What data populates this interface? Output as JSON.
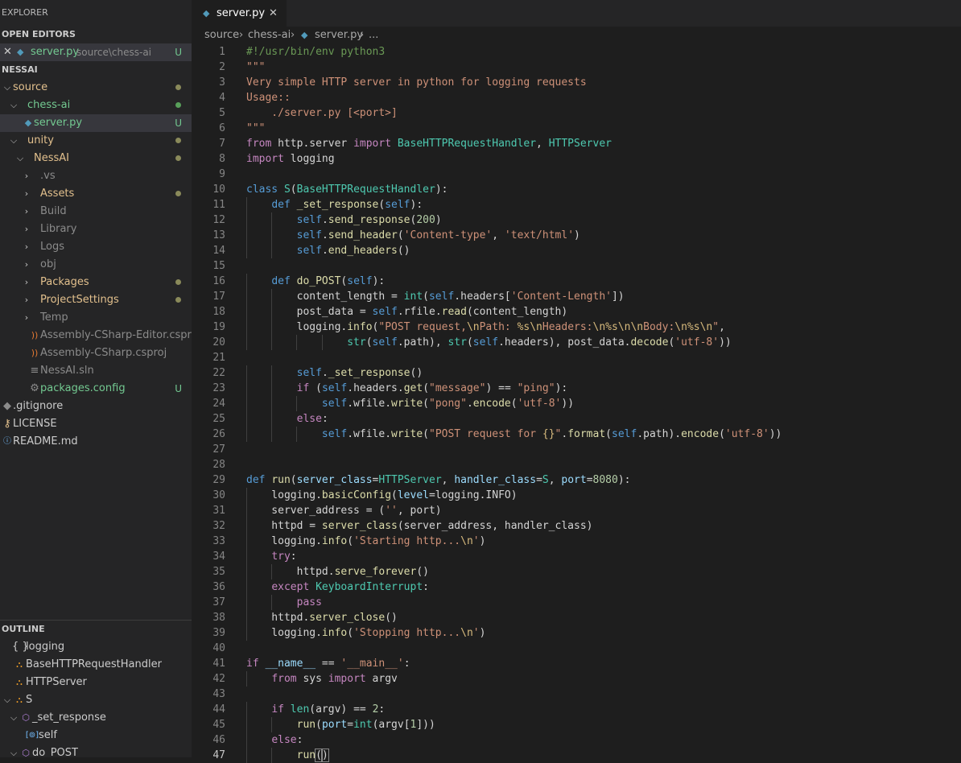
{
  "explorer": {
    "title": "EXPLORER"
  },
  "open_editors": {
    "title": "OPEN EDITORS",
    "items": [
      {
        "close": "✕",
        "name": "server.py",
        "path": "source\\chess-ai",
        "badge": "U"
      }
    ]
  },
  "workspace": {
    "title": "NESSAI",
    "tree": [
      {
        "label": "source",
        "chevron": "⌵",
        "status": "modified"
      },
      {
        "label": "chess-ai",
        "chevron": "⌵",
        "status": "untracked"
      },
      {
        "label": "server.py",
        "icon": "python-file-icon",
        "badge": "U",
        "selected": true
      },
      {
        "label": "unity",
        "chevron": "⌵",
        "status": "modified"
      },
      {
        "label": "NessAI",
        "chevron": "⌵",
        "status": "modified"
      },
      {
        "label": ".vs",
        "chevron": "›"
      },
      {
        "label": "Assets",
        "chevron": "›",
        "status": "modified"
      },
      {
        "label": "Build",
        "chevron": "›"
      },
      {
        "label": "Library",
        "chevron": "›"
      },
      {
        "label": "Logs",
        "chevron": "›"
      },
      {
        "label": "obj",
        "chevron": "›"
      },
      {
        "label": "Packages",
        "chevron": "›",
        "status": "modified"
      },
      {
        "label": "ProjectSettings",
        "chevron": "›",
        "status": "modified"
      },
      {
        "label": "Temp",
        "chevron": "›"
      },
      {
        "label": "Assembly-CSharp-Editor.csproj",
        "icon": "rss-icon"
      },
      {
        "label": "Assembly-CSharp.csproj",
        "icon": "rss-icon"
      },
      {
        "label": "NessAI.sln",
        "icon": "lines-icon"
      },
      {
        "label": "packages.config",
        "icon": "gear-icon",
        "badge": "U"
      },
      {
        "label": ".gitignore",
        "icon": "diamond-icon"
      },
      {
        "label": "LICENSE",
        "icon": "key-icon"
      },
      {
        "label": "README.md",
        "icon": "info-icon"
      }
    ]
  },
  "outline": {
    "title": "OUTLINE",
    "items": [
      {
        "label": "logging",
        "icon": "braces-icon"
      },
      {
        "label": "BaseHTTPRequestHandler",
        "icon": "class-icon"
      },
      {
        "label": "HTTPServer",
        "icon": "class-icon"
      },
      {
        "label": "S",
        "icon": "class-icon",
        "chevron": "⌵"
      },
      {
        "label": "_set_response",
        "icon": "method-icon",
        "chevron": "⌵"
      },
      {
        "label": "self",
        "icon": "variable-icon"
      },
      {
        "label": "do_POST",
        "icon": "method-icon",
        "chevron": "⌵"
      }
    ]
  },
  "editor": {
    "tab": {
      "label": "server.py",
      "close": "✕"
    },
    "breadcrumb": [
      "source",
      "chess-ai",
      "server.py",
      "..."
    ],
    "breadcrumb_sep": "›",
    "lines": [
      "#!/usr/bin/env python3",
      "\"\"\"",
      "Very simple HTTP server in python for logging requests",
      "Usage::",
      "    ./server.py [<port>]",
      "\"\"\"",
      "from http.server import BaseHTTPRequestHandler, HTTPServer",
      "import logging",
      "",
      "class S(BaseHTTPRequestHandler):",
      "    def _set_response(self):",
      "        self.send_response(200)",
      "        self.send_header('Content-type', 'text/html')",
      "        self.end_headers()",
      "",
      "    def do_POST(self):",
      "        content_length = int(self.headers['Content-Length'])",
      "        post_data = self.rfile.read(content_length)",
      "        logging.info(\"POST request,\\nPath: %s\\nHeaders:\\n%s\\n\\nBody:\\n%s\\n\",",
      "                str(self.path), str(self.headers), post_data.decode('utf-8'))",
      "",
      "        self._set_response()",
      "        if (self.headers.get(\"message\") == \"ping\"):",
      "            self.wfile.write(\"pong\".encode('utf-8'))",
      "        else:",
      "            self.wfile.write(\"POST request for {}\".format(self.path).encode('utf-8'))",
      "",
      "",
      "def run(server_class=HTTPServer, handler_class=S, port=8080):",
      "    logging.basicConfig(level=logging.INFO)",
      "    server_address = ('', port)",
      "    httpd = server_class(server_address, handler_class)",
      "    logging.info('Starting http...\\n')",
      "    try:",
      "        httpd.serve_forever()",
      "    except KeyboardInterrupt:",
      "        pass",
      "    httpd.server_close()",
      "    logging.info('Stopping http...\\n')",
      "",
      "if __name__ == '__main__':",
      "    from sys import argv",
      "",
      "    if len(argv) == 2:",
      "        run(port=int(argv[1]))",
      "    else:",
      "        run()"
    ],
    "current_line": 47,
    "colors": {
      "keyword": "#569cd6",
      "control": "#c586c0",
      "string": "#ce9178",
      "function": "#dcdcaa",
      "comment": "#6a9955",
      "type": "#4ec9b0",
      "number": "#b5cea8",
      "variable": "#9cdcfe",
      "escape": "#d7ba7d"
    }
  }
}
